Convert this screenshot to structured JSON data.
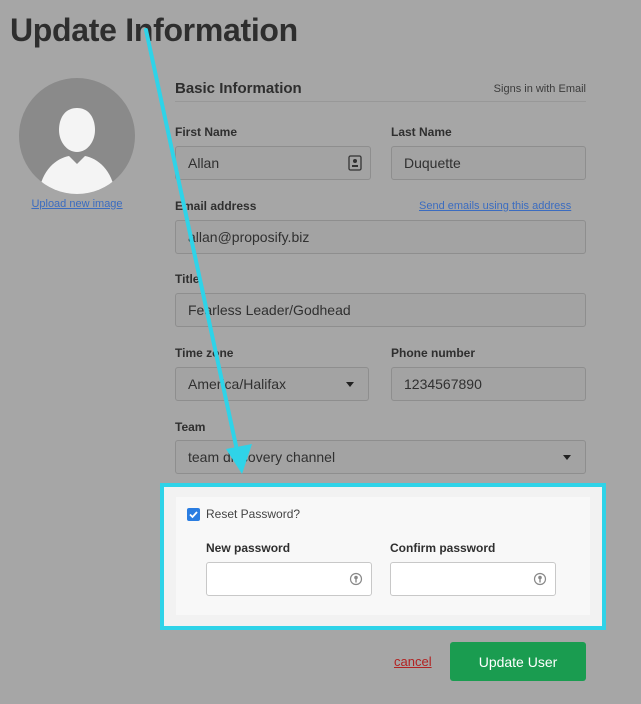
{
  "page": {
    "title": "Update Information"
  },
  "avatar": {
    "upload_label": "Upload new image"
  },
  "basic": {
    "section_title": "Basic Information",
    "signin_note": "Signs in with Email",
    "first_name": {
      "label": "First Name",
      "value": "Allan"
    },
    "last_name": {
      "label": "Last Name",
      "value": "Duquette"
    },
    "email": {
      "label": "Email address",
      "value": "allan@proposify.biz",
      "link": "Send emails using this address"
    },
    "title": {
      "label": "Title",
      "value": "Fearless Leader/Godhead"
    },
    "timezone": {
      "label": "Time zone",
      "value": "America/Halifax"
    },
    "phone": {
      "label": "Phone number",
      "value": "1234567890"
    },
    "team": {
      "label": "Team",
      "value": "team discovery channel"
    }
  },
  "password": {
    "reset_label": "Reset Password?",
    "reset_checked": true,
    "new_label": "New password",
    "confirm_label": "Confirm password"
  },
  "actions": {
    "cancel_label": "cancel",
    "submit_label": "Update User"
  },
  "colors": {
    "highlight": "#2fd3e8",
    "primary_button": "#1a9c50",
    "link": "#3b6cc0",
    "cancel": "#b22222",
    "checkbox": "#2a7de1"
  },
  "icons": [
    "user-silhouette-icon",
    "id-card-icon",
    "chevron-down-icon",
    "key-icon",
    "checkmark-icon",
    "annotation-arrow-icon"
  ]
}
